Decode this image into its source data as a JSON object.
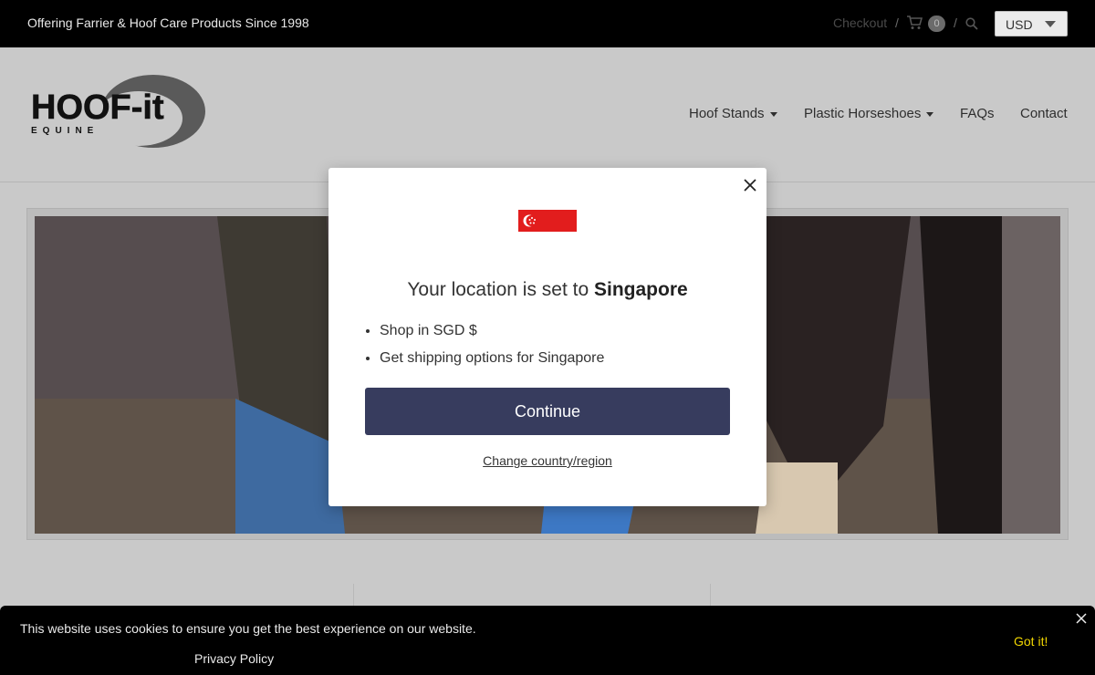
{
  "topbar": {
    "tagline": "Offering Farrier & Hoof Care Products Since 1998",
    "checkout_label": "Checkout",
    "separator": "/",
    "cart_count": "0",
    "currency": "USD"
  },
  "header": {
    "logo_text": "HOOF-it",
    "logo_subtext": "EQUINE",
    "nav": {
      "hoof_stands": "Hoof Stands",
      "plastic_horseshoes": "Plastic Horseshoes",
      "faqs": "FAQs",
      "contact": "Contact"
    }
  },
  "modal": {
    "title_prefix": "Your location is set to ",
    "country": "Singapore",
    "bullets": [
      "Shop in SGD $",
      "Get shipping options for Singapore"
    ],
    "continue_label": "Continue",
    "change_label": "Change country/region"
  },
  "cookie": {
    "message": "This website uses cookies to ensure you get the best experience on our website.",
    "policy_label": "Privacy Policy",
    "accept_label": "Got it!"
  },
  "colors": {
    "continue_button": "#373c5e",
    "accept_link": "#f1d600",
    "flag_red": "#e21d1d"
  }
}
